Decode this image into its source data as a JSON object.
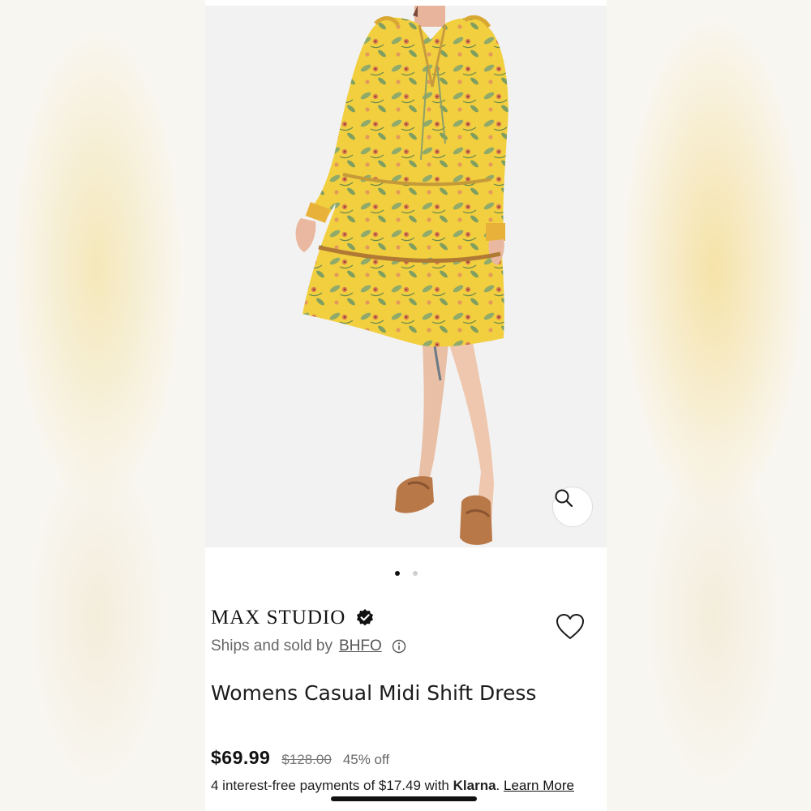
{
  "product": {
    "brand": "MAX STUDIO",
    "seller_prefix": "Ships and sold by",
    "seller_name": "BHFO",
    "title": "Womens Casual Midi Shift Dress",
    "price": "$69.99",
    "original_price": "$128.00",
    "discount": "45% off"
  },
  "gallery": {
    "image_count": 2,
    "active_index": 0
  },
  "financing": {
    "prefix": "4 interest-free payments of $17.49 with",
    "provider": "Klarna",
    "suffix": ".",
    "link_label": "Learn More"
  },
  "icons": {
    "zoom": "magnifier-icon",
    "verified": "verified-badge-icon",
    "favorite": "heart-icon",
    "info": "info-icon"
  },
  "colors": {
    "dress": "#f2cf3e",
    "accent_text": "#111111",
    "muted_text": "#666666"
  }
}
